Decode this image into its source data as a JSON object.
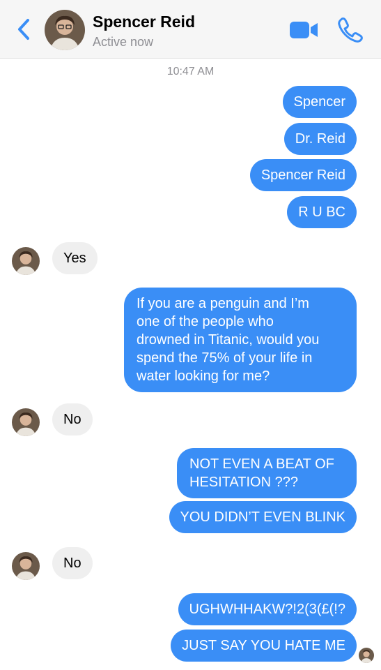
{
  "header": {
    "name": "Spencer Reid",
    "status": "Active now",
    "accent_color": "#3a8ef6",
    "icons": [
      "chevron-left-icon",
      "video-camera-icon",
      "phone-icon"
    ]
  },
  "timestamp": "10:47 AM",
  "messages": [
    {
      "from": "me",
      "text": "Spencer"
    },
    {
      "from": "me",
      "text": "Dr. Reid"
    },
    {
      "from": "me",
      "text": "Spencer Reid"
    },
    {
      "from": "me",
      "text": "R U BC"
    },
    {
      "from": "them",
      "text": "Yes"
    },
    {
      "from": "me",
      "lines": [
        "If you are a penguin and I’m",
        "one of the people who",
        "drowned in Titanic, would you",
        "spend the 75% of your life in",
        "water looking for me?"
      ]
    },
    {
      "from": "them",
      "text": "No"
    },
    {
      "from": "me",
      "lines": [
        "NOT EVEN A BEAT OF",
        "HESITATION ???"
      ]
    },
    {
      "from": "me",
      "text": "YOU DIDN’T EVEN BLINK"
    },
    {
      "from": "them",
      "text": "No"
    },
    {
      "from": "me",
      "text": "UGHWHHAKW?!2(3(£(!?"
    },
    {
      "from": "me",
      "text": "JUST SAY YOU HATE ME"
    }
  ]
}
